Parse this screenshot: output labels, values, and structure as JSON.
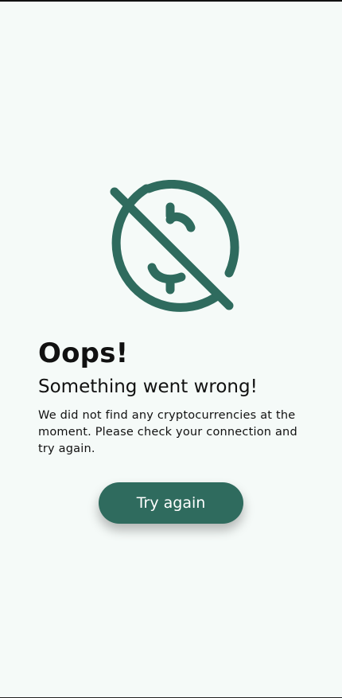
{
  "error_screen": {
    "icon": "no-money-icon",
    "title": "Oops!",
    "subtitle": "Something went wrong!",
    "message": "We did not find any cryptocurrencies at the moment. Please check your connection and try again.",
    "retry_label": "Try again"
  },
  "colors": {
    "background": "#f5faf8",
    "accent": "#2f6b5e",
    "text": "#111111"
  }
}
